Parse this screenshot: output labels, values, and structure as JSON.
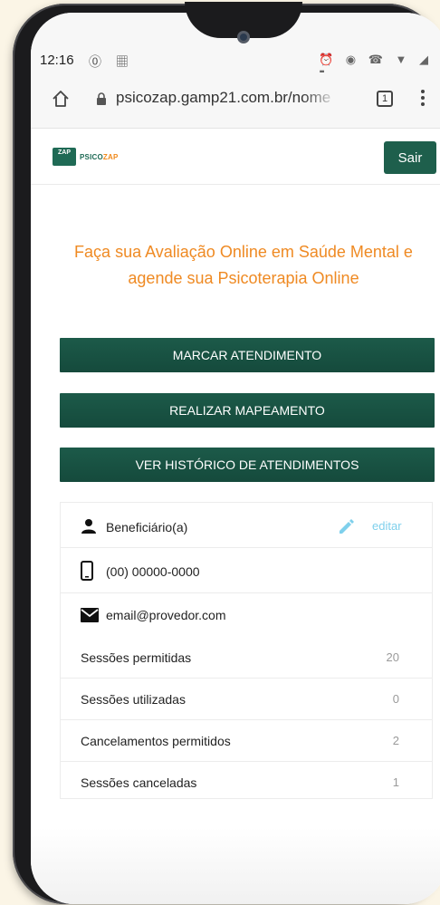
{
  "status_bar": {
    "time": "12:16",
    "left_icons": "⓪ ▦",
    "right_icons": "⏰ ◉ ☎ ▼ ◢ ▮"
  },
  "browser": {
    "url": "psicozap.gamp21.com.br/nome",
    "tab_count": "1"
  },
  "header": {
    "logo_badge": "ZAP",
    "logo_text_prefix": "PSICO",
    "logo_text_suffix": "ZAP",
    "sair_label": "Sair"
  },
  "headline": "Faça sua Avaliação Online em Saúde Mental e agende sua Psicoterapia Online",
  "actions": {
    "marcar": "MARCAR ATENDIMENTO",
    "mapeamento": "REALIZAR MAPEAMENTO",
    "historico": "VER HISTÓRICO DE ATENDIMENTOS"
  },
  "profile": {
    "name": "Beneficiário(a)",
    "edit_label": "editar",
    "phone": "(00) 00000-0000",
    "email": "email@provedor.com"
  },
  "stats": [
    {
      "label": "Sessões permitidas",
      "value": "20"
    },
    {
      "label": "Sessões utilizadas",
      "value": "0"
    },
    {
      "label": "Cancelamentos permitidos",
      "value": "2"
    },
    {
      "label": "Sessões canceladas",
      "value": "1"
    }
  ],
  "colors": {
    "brand_green": "#1e5f4c",
    "headline_orange": "#ef8a23",
    "edit_blue": "#7fd0ec"
  },
  "icons": [
    "home-icon",
    "lock-icon",
    "more-icon",
    "person-icon",
    "pencil-icon",
    "phone-icon",
    "mail-icon"
  ]
}
